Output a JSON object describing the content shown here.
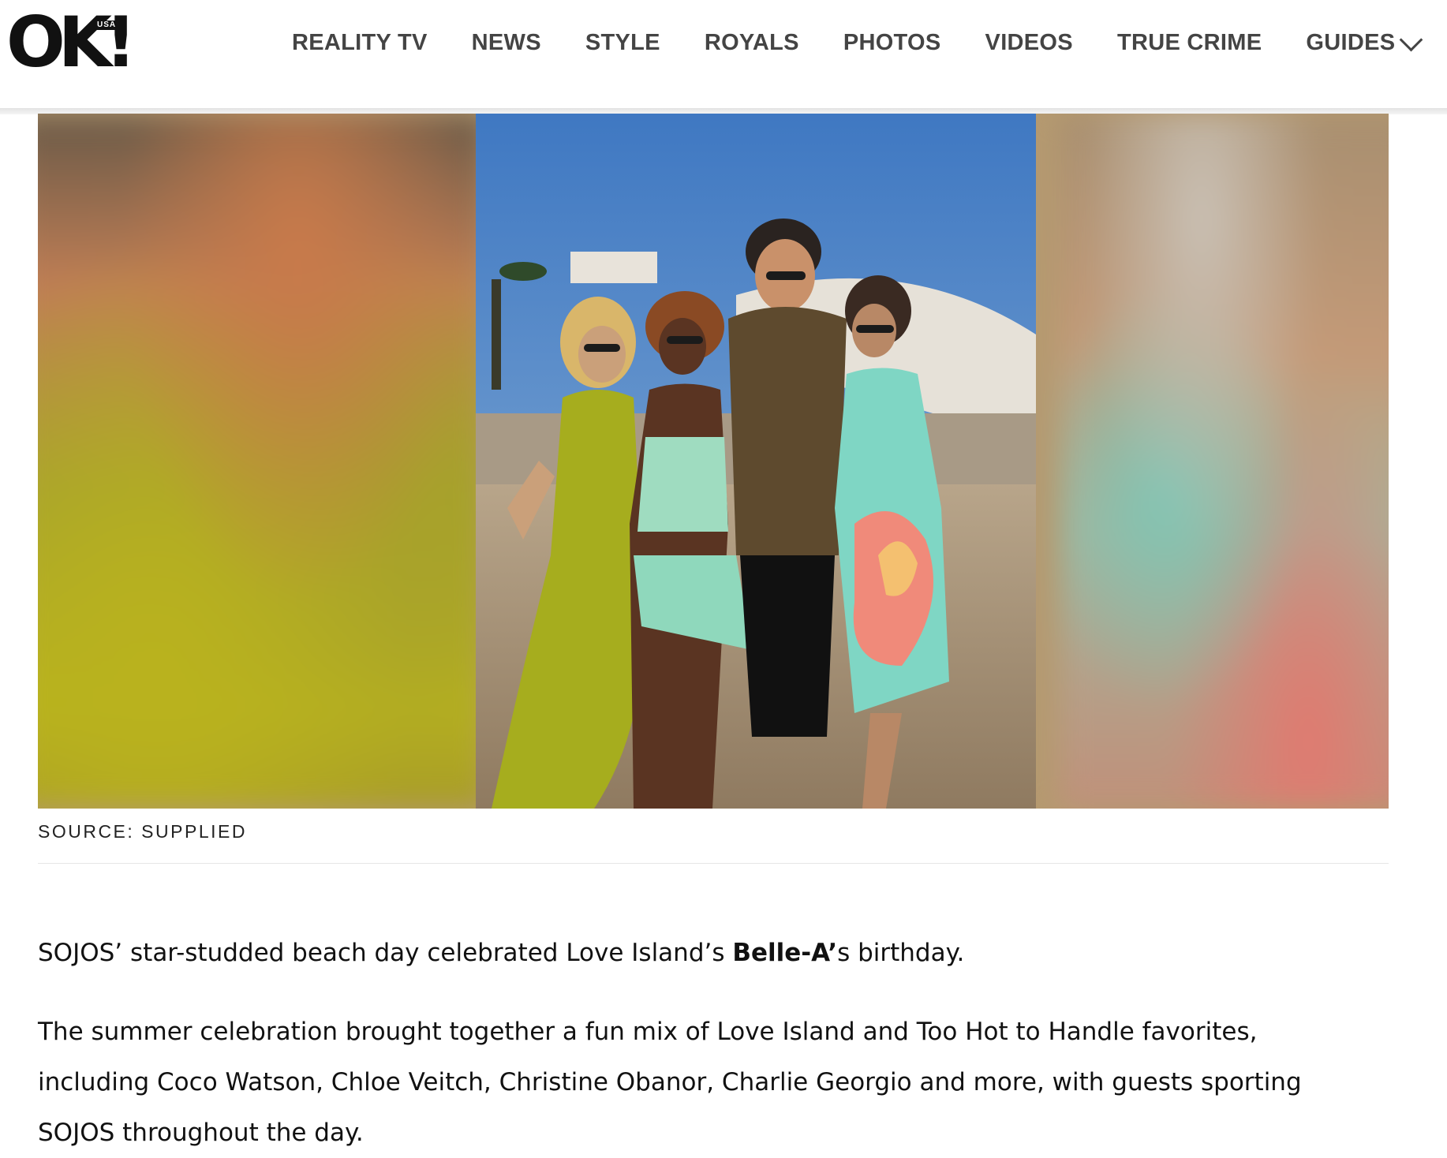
{
  "header": {
    "logo": {
      "text": "OK!",
      "badge": "USA"
    },
    "nav": [
      {
        "label": "REALITY TV"
      },
      {
        "label": "NEWS"
      },
      {
        "label": "STYLE"
      },
      {
        "label": "ROYALS"
      },
      {
        "label": "PHOTOS"
      },
      {
        "label": "VIDEOS"
      },
      {
        "label": "TRUE CRIME"
      },
      {
        "label": "GUIDES"
      }
    ],
    "dropdown_icon": "chevron-down-icon"
  },
  "figure": {
    "caption": "SOURCE: SUPPLIED"
  },
  "article": {
    "p1": {
      "before": "SOJOS’ star-studded beach day celebrated Love Island’s ",
      "bold": "Belle-A’",
      "after": "s birthday."
    },
    "p2": {
      "lines": [
        "The summer celebration brought together a fun mix of Love Island and Too Hot to Handle favorites,",
        "including Coco Watson, Chloe Veitch, Christine Obanor, Charlie Georgio and more, with guests sporting",
        "SOJOS throughout the day."
      ]
    }
  },
  "colors": {
    "nav_text": "#444444",
    "body_text": "#111111",
    "caption_text": "#222222"
  }
}
